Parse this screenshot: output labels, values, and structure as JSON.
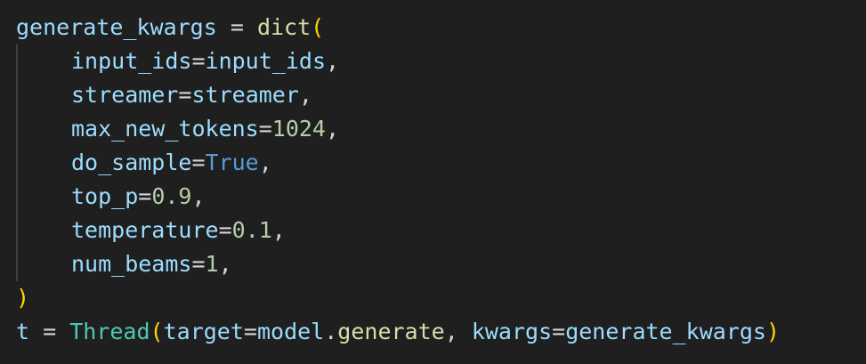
{
  "theme": {
    "background": "#1f1f1f",
    "colors": {
      "variable": "#9cdcfe",
      "operator": "#d4d4d4",
      "function": "#dcdcaa",
      "class": "#4ec9b0",
      "bracket": "#ffd700",
      "number": "#b5cea8",
      "keyword_constant": "#569cd6"
    }
  },
  "code_lines": [
    {
      "indent": false,
      "tokens": [
        {
          "text": "generate_kwargs",
          "kind": "variable"
        },
        {
          "text": " = ",
          "kind": "operator"
        },
        {
          "text": "dict",
          "kind": "function"
        },
        {
          "text": "(",
          "kind": "bracket"
        }
      ]
    },
    {
      "indent": true,
      "tokens": [
        {
          "text": "input_ids",
          "kind": "variable"
        },
        {
          "text": "=",
          "kind": "operator"
        },
        {
          "text": "input_ids",
          "kind": "variable"
        },
        {
          "text": ",",
          "kind": "operator"
        }
      ]
    },
    {
      "indent": true,
      "tokens": [
        {
          "text": "streamer",
          "kind": "variable"
        },
        {
          "text": "=",
          "kind": "operator"
        },
        {
          "text": "streamer",
          "kind": "variable"
        },
        {
          "text": ",",
          "kind": "operator"
        }
      ]
    },
    {
      "indent": true,
      "tokens": [
        {
          "text": "max_new_tokens",
          "kind": "variable"
        },
        {
          "text": "=",
          "kind": "operator"
        },
        {
          "text": "1024",
          "kind": "number"
        },
        {
          "text": ",",
          "kind": "operator"
        }
      ]
    },
    {
      "indent": true,
      "tokens": [
        {
          "text": "do_sample",
          "kind": "variable"
        },
        {
          "text": "=",
          "kind": "operator"
        },
        {
          "text": "True",
          "kind": "keyword_constant"
        },
        {
          "text": ",",
          "kind": "operator"
        }
      ]
    },
    {
      "indent": true,
      "tokens": [
        {
          "text": "top_p",
          "kind": "variable"
        },
        {
          "text": "=",
          "kind": "operator"
        },
        {
          "text": "0.9",
          "kind": "number"
        },
        {
          "text": ",",
          "kind": "operator"
        }
      ]
    },
    {
      "indent": true,
      "tokens": [
        {
          "text": "temperature",
          "kind": "variable"
        },
        {
          "text": "=",
          "kind": "operator"
        },
        {
          "text": "0.1",
          "kind": "number"
        },
        {
          "text": ",",
          "kind": "operator"
        }
      ]
    },
    {
      "indent": true,
      "tokens": [
        {
          "text": "num_beams",
          "kind": "variable"
        },
        {
          "text": "=",
          "kind": "operator"
        },
        {
          "text": "1",
          "kind": "number"
        },
        {
          "text": ",",
          "kind": "operator"
        }
      ]
    },
    {
      "indent": false,
      "tokens": [
        {
          "text": ")",
          "kind": "bracket"
        }
      ]
    },
    {
      "indent": false,
      "tokens": [
        {
          "text": "t",
          "kind": "variable"
        },
        {
          "text": " = ",
          "kind": "operator"
        },
        {
          "text": "Thread",
          "kind": "class"
        },
        {
          "text": "(",
          "kind": "bracket"
        },
        {
          "text": "target",
          "kind": "variable"
        },
        {
          "text": "=",
          "kind": "operator"
        },
        {
          "text": "model",
          "kind": "variable"
        },
        {
          "text": ".",
          "kind": "operator"
        },
        {
          "text": "generate",
          "kind": "function"
        },
        {
          "text": ", ",
          "kind": "operator"
        },
        {
          "text": "kwargs",
          "kind": "variable"
        },
        {
          "text": "=",
          "kind": "operator"
        },
        {
          "text": "generate_kwargs",
          "kind": "variable"
        },
        {
          "text": ")",
          "kind": "bracket"
        }
      ]
    }
  ]
}
